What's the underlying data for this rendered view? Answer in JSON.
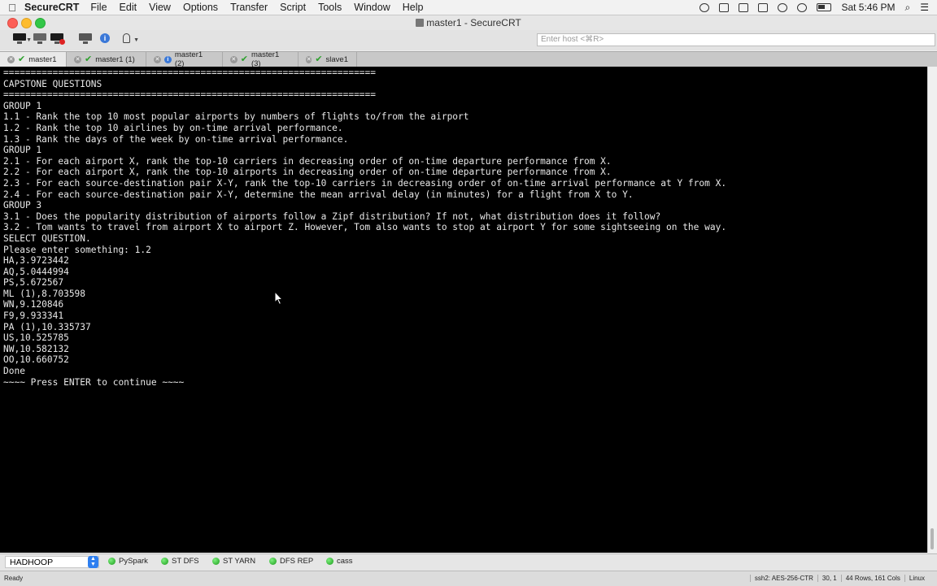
{
  "menubar": {
    "app": "SecureCRT",
    "items": [
      "File",
      "Edit",
      "View",
      "Options",
      "Transfer",
      "Script",
      "Tools",
      "Window",
      "Help"
    ],
    "clock": "Sat 5:46 PM"
  },
  "window": {
    "title": "master1 - SecureCRT"
  },
  "toolbar": {
    "host_placeholder": "Enter host <⌘R>"
  },
  "tabs": [
    {
      "label": "master1",
      "status": "ok",
      "active": true
    },
    {
      "label": "master1 (1)",
      "status": "ok",
      "active": false
    },
    {
      "label": "master1 (2)",
      "status": "info",
      "active": false
    },
    {
      "label": "master1 (3)",
      "status": "ok",
      "active": false
    },
    {
      "label": "slave1",
      "status": "ok",
      "active": false
    }
  ],
  "terminal": {
    "lines": [
      "====================================================================",
      "CAPSTONE QUESTIONS",
      "====================================================================",
      "GROUP 1",
      "1.1 - Rank the top 10 most popular airports by numbers of flights to/from the airport",
      "1.2 - Rank the top 10 airlines by on-time arrival performance.",
      "1.3 - Rank the days of the week by on-time arrival performance.",
      "GROUP 1",
      "2.1 - For each airport X, rank the top-10 carriers in decreasing order of on-time departure performance from X.",
      "2.2 - For each airport X, rank the top-10 airports in decreasing order of on-time departure performance from X.",
      "2.3 - For each source-destination pair X-Y, rank the top-10 carriers in decreasing order of on-time arrival performance at Y from X.",
      "2.4 - For each source-destination pair X-Y, determine the mean arrival delay (in minutes) for a flight from X to Y.",
      "GROUP 3",
      "3.1 - Does the popularity distribution of airports follow a Zipf distribution? If not, what distribution does it follow?",
      "3.2 - Tom wants to travel from airport X to airport Z. However, Tom also wants to stop at airport Y for some sightseeing on the way.",
      "SELECT QUESTION.",
      "Please enter something: 1.2",
      "HA,3.9723442",
      "AQ,5.0444994",
      "PS,5.672567",
      "ML (1),8.703598",
      "WN,9.120846",
      "F9,9.933341",
      "PA (1),10.335737",
      "US,10.525785",
      "NW,10.582132",
      "OO,10.660752",
      "Done",
      "~~~~ Press ENTER to continue ~~~~"
    ]
  },
  "buttonbar": {
    "session_group": "HADHOOP",
    "buttons": [
      "PySpark",
      "ST DFS",
      "ST YARN",
      "DFS REP",
      "cass"
    ]
  },
  "status": {
    "ready": "Ready",
    "cipher": "ssh2: AES-256-CTR",
    "position": "30, 1",
    "size": "44 Rows, 161 Cols",
    "os": "Linux"
  }
}
